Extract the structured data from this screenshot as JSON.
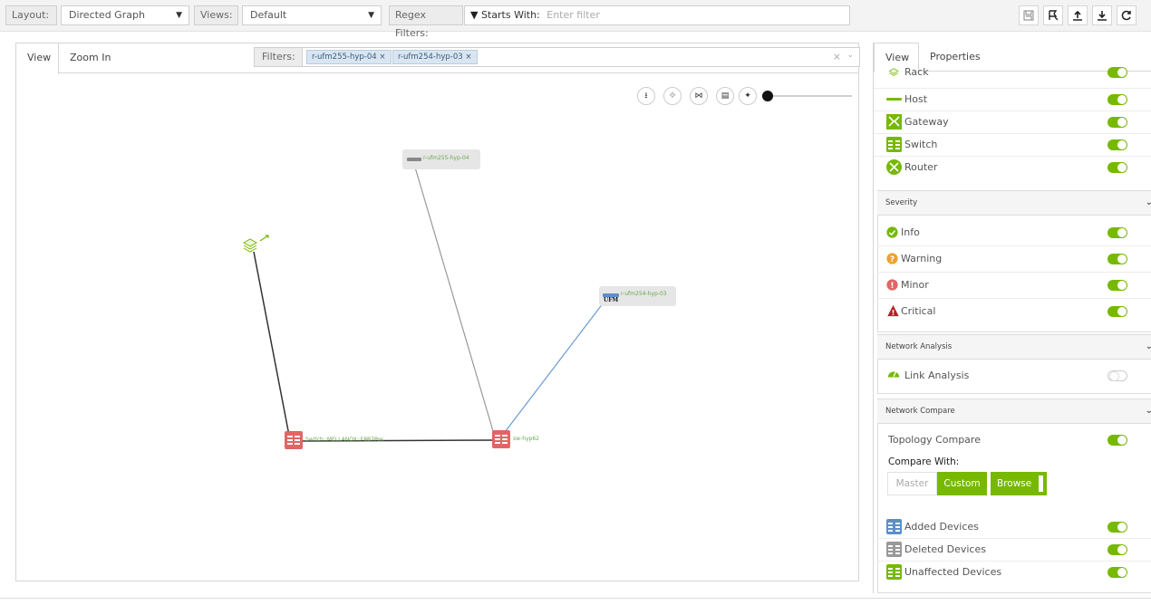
{
  "toolbar": {
    "layout_label": "Layout:",
    "layout_value": "Directed Graph",
    "views_label": "Views:",
    "views_value": "Default",
    "regex_label": "Regex Filters:",
    "starts_with_label": "Starts With:",
    "filter_placeholder": "Enter filter",
    "buttons": [
      "save-icon",
      "fork-icon",
      "upload-icon",
      "download-icon",
      "refresh-icon"
    ]
  },
  "left_panel": {
    "tabs": [
      "View",
      "Zoom In"
    ],
    "filters_label": "Filters:",
    "filter_chips": [
      "r-ufm255-hyp-04",
      "r-ufm254-hyp-03"
    ],
    "clear_symbol": "×",
    "zoom_controls": [
      "download-icon",
      "move-icon",
      "fit-icon",
      "fullscreen-icon",
      "center-icon"
    ],
    "zoom_level": 0.0
  },
  "graph": {
    "nodes": [
      {
        "label": "r-ufm255-hyp-04",
        "type": "host"
      },
      {
        "label": "r-ufm254-hyp-03",
        "type": "host",
        "badge": "UFM"
      },
      {
        "label": "",
        "type": "rack"
      },
      {
        "label": "Switch::MELLANOX::F8B7Pos",
        "type": "switch"
      },
      {
        "label": "sw-hyp62",
        "type": "switch"
      }
    ],
    "link_colors": {
      "default": "#999999",
      "dark": "#333333",
      "added": "#6b9bd1"
    }
  },
  "right_panel": {
    "tabs": [
      "View",
      "Properties"
    ],
    "device_types": [
      {
        "label": "Rack",
        "on": true
      },
      {
        "label": "Host",
        "on": true
      },
      {
        "label": "Gateway",
        "on": true
      },
      {
        "label": "Switch",
        "on": true
      },
      {
        "label": "Router",
        "on": true
      }
    ],
    "severity": {
      "title": "Severity",
      "items": [
        {
          "label": "Info",
          "on": true,
          "color": "#76b900"
        },
        {
          "label": "Warning",
          "on": true,
          "color": "#f0a030"
        },
        {
          "label": "Minor",
          "on": true,
          "color": "#e06666"
        },
        {
          "label": "Critical",
          "on": true,
          "color": "#b22222"
        }
      ]
    },
    "network_analysis": {
      "title": "Network Analysis",
      "items": [
        {
          "label": "Link Analysis",
          "on": false
        }
      ]
    },
    "network_compare": {
      "title": "Network Compare",
      "topology_label": "Topology Compare",
      "topology_on": true,
      "compare_with_label": "Compare With:",
      "buttons": [
        "Master",
        "Custom",
        "Browse"
      ],
      "legend": [
        {
          "label": "Added Devices",
          "on": true,
          "color": "#5b8fc9"
        },
        {
          "label": "Deleted Devices",
          "on": true,
          "color": "#999999"
        },
        {
          "label": "Unaffected Devices",
          "on": true,
          "color": "#76b900"
        }
      ]
    }
  },
  "colors": {
    "accent": "#76b900",
    "switch": "#e06666",
    "link_added": "#6b9bd1"
  }
}
